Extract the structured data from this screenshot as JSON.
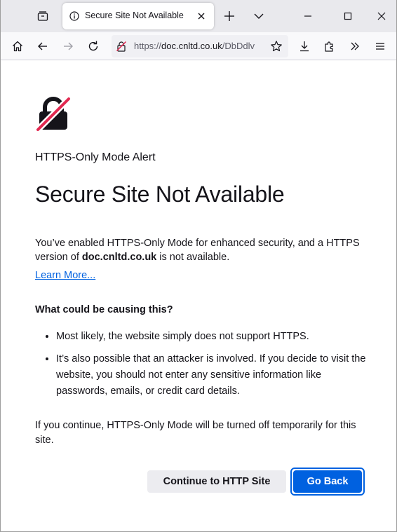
{
  "tab": {
    "title": "Secure Site Not Available",
    "icon": "info-icon"
  },
  "toolbar": {
    "url_prefix": "https://",
    "url_domain": "doc.cnltd.co.uk",
    "url_path": "/DbDdlv"
  },
  "page": {
    "subtitle": "HTTPS-Only Mode Alert",
    "title": "Secure Site Not Available",
    "intro_before": "You’ve enabled HTTPS-Only Mode for enhanced security, and a HTTPS version of ",
    "intro_domain": "doc.cnltd.co.uk",
    "intro_after": " is not available.",
    "learn_more": "Learn More...",
    "causes_heading": "What could be causing this?",
    "causes": [
      "Most likely, the website simply does not support HTTPS.",
      "It’s also possible that an attacker is involved. If you decide to visit the website, you should not enter any sensitive information like passwords, emails, or credit card details."
    ],
    "continue_note": "If you continue, HTTPS-Only Mode will be turned off temporarily for this site.",
    "continue_button": "Continue to HTTP Site",
    "go_back_button": "Go Back"
  },
  "colors": {
    "accent": "#0061e0",
    "alert_stroke": "#e22850",
    "chrome_bg": "#e9e9ed"
  }
}
